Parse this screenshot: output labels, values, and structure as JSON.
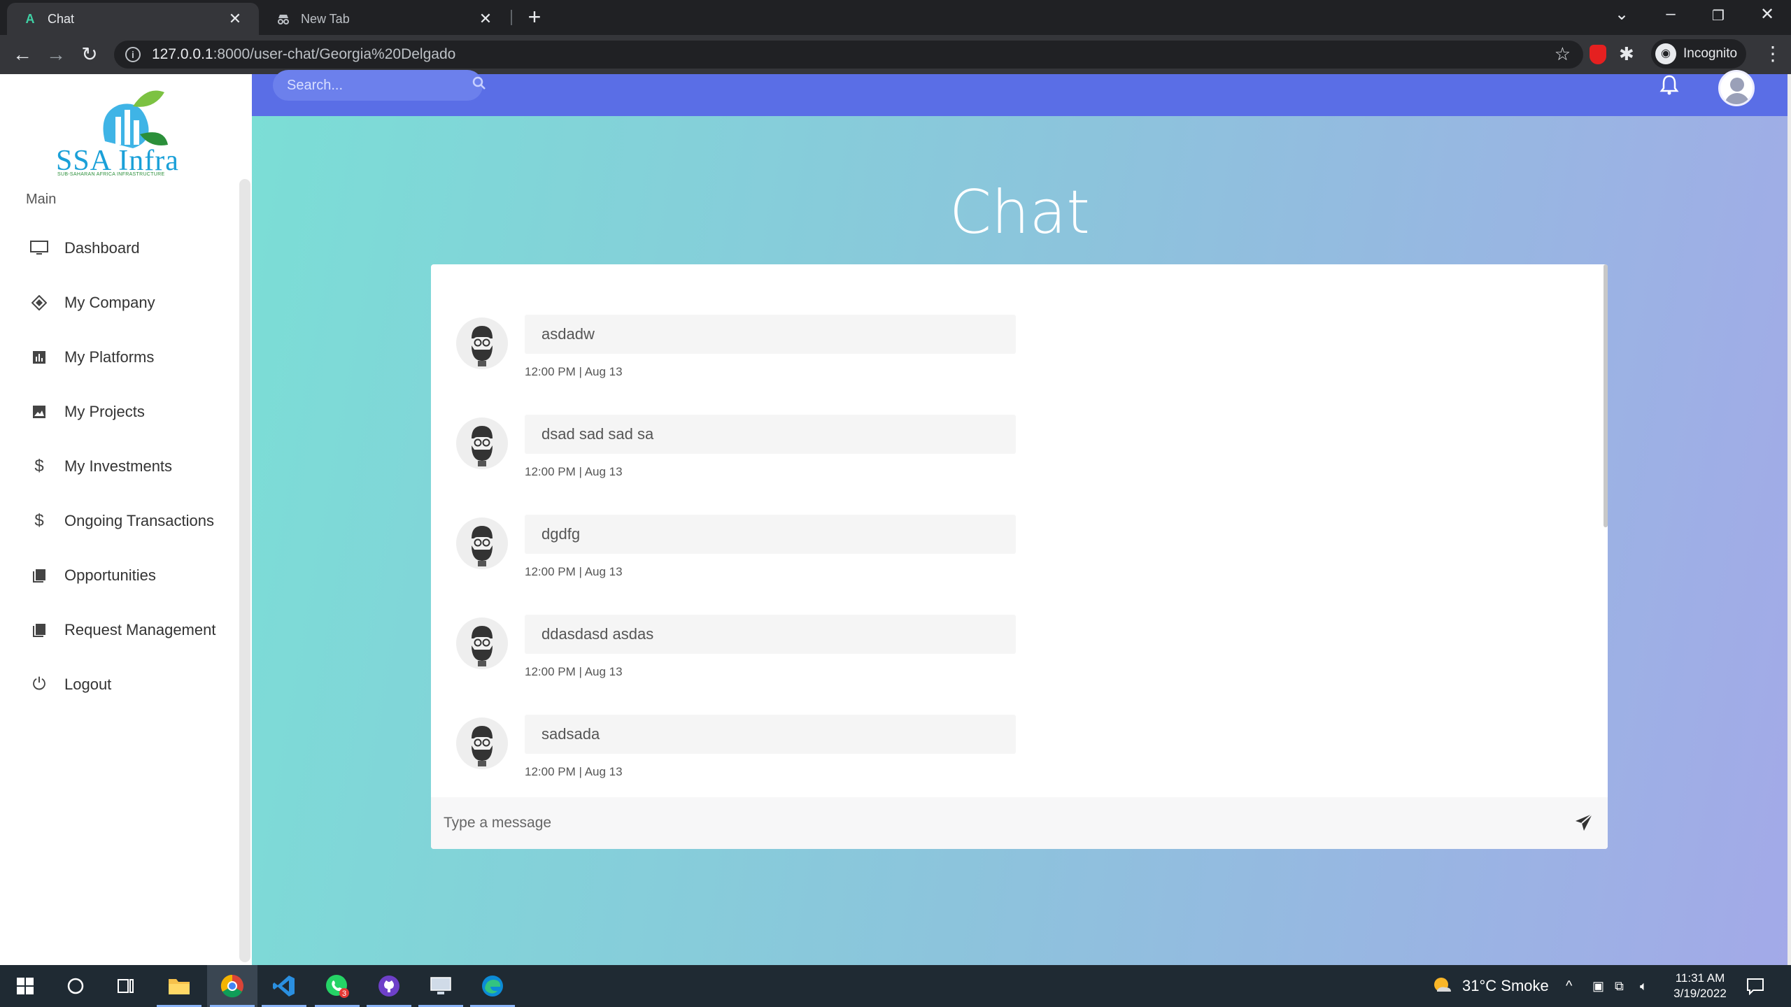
{
  "browser": {
    "tabs": [
      {
        "title": "Chat",
        "favicon": "A",
        "active": true
      },
      {
        "title": "New Tab",
        "favicon": "incognito-icon",
        "active": false
      }
    ],
    "url_host": "127.0.0.1",
    "url_rest": ":8000/user-chat/Georgia%20Delgado",
    "profile_label": "Incognito"
  },
  "sidebar": {
    "brand": "SSA Infra",
    "tagline": "SUB-SAHARAN AFRICA INFRASTRUCTURE",
    "section": "Main",
    "items": [
      {
        "label": "Dashboard",
        "icon": "monitor-icon"
      },
      {
        "label": "My Company",
        "icon": "diamond-icon"
      },
      {
        "label": "My Platforms",
        "icon": "bar-chart-icon"
      },
      {
        "label": "My Projects",
        "icon": "image-icon"
      },
      {
        "label": "My Investments",
        "icon": "dollar-icon"
      },
      {
        "label": "Ongoing Transactions",
        "icon": "dollar-icon"
      },
      {
        "label": "Opportunities",
        "icon": "book-icon"
      },
      {
        "label": "Request Management",
        "icon": "book-icon"
      },
      {
        "label": "Logout",
        "icon": "power-icon"
      }
    ]
  },
  "topnav": {
    "search_placeholder": "Search..."
  },
  "page": {
    "title": "Chat"
  },
  "chat": {
    "messages": [
      {
        "text": "asdadw",
        "time": "12:00 PM | Aug 13"
      },
      {
        "text": "dsad sad sad sa",
        "time": "12:00 PM | Aug 13"
      },
      {
        "text": "dgdfg",
        "time": "12:00 PM | Aug 13"
      },
      {
        "text": "ddasdasd asdas",
        "time": "12:00 PM | Aug 13"
      },
      {
        "text": "sadsada",
        "time": "12:00 PM | Aug 13"
      }
    ],
    "input_placeholder": "Type a message"
  },
  "taskbar": {
    "weather": "31°C  Smoke",
    "time": "11:31 AM",
    "date": "3/19/2022",
    "whatsapp_badge": "3"
  }
}
